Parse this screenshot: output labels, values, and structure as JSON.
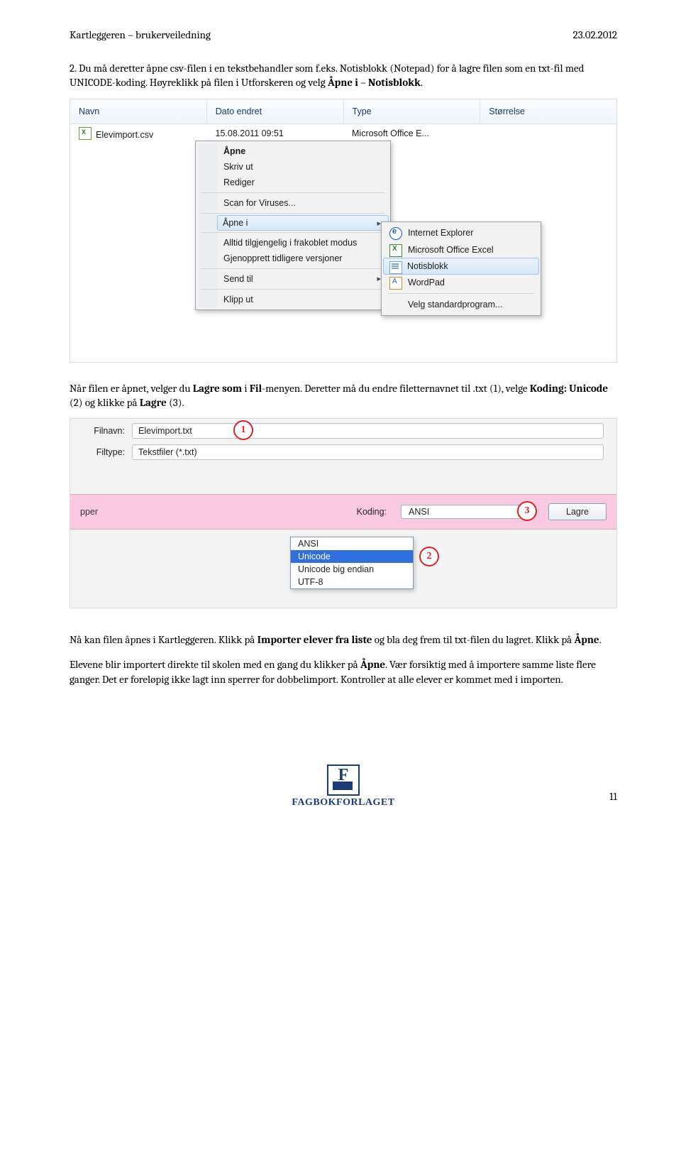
{
  "header": {
    "left": "Kartleggeren – brukerveiledning",
    "right": "23.02.2012"
  },
  "para1_pre": "2.  Du må deretter åpne csv-filen i en tekstbehandler som f.eks. Notisblokk (Notepad) for å lagre filen som en txt-fil med UNICODE-koding. Høyreklikk på filen i Utforskeren og velg ",
  "para1_b1": "Åpne i",
  "para1_mid": " – ",
  "para1_b2": "Notisblokk",
  "para1_end": ".",
  "explorer": {
    "cols": {
      "name": "Navn",
      "date": "Dato endret",
      "type": "Type",
      "size": "Størrelse"
    },
    "file": {
      "name": "Elevimport.csv",
      "date": "15.08.2011 09:51",
      "type": "Microsoft Office E..."
    }
  },
  "ctx": {
    "open": "Åpne",
    "print": "Skriv ut",
    "edit": "Rediger",
    "scan": "Scan for Viruses...",
    "openin": "Åpne i",
    "offline": "Alltid tilgjengelig i frakoblet modus",
    "restore": "Gjenopprett tidligere versjoner",
    "sendto": "Send til",
    "cut": "Klipp ut"
  },
  "submenu": {
    "ie": "Internet Explorer",
    "excel": "Microsoft Office Excel",
    "notepad": "Notisblokk",
    "wordpad": "WordPad",
    "default": "Velg standardprogram..."
  },
  "para2_pre": "Når filen er åpnet, velger du ",
  "para2_b1": "Lagre som",
  "para2_mid1": " i ",
  "para2_b2": "Fil",
  "para2_mid2": "-menyen. Deretter må du endre filetternavnet til .txt (1), velge ",
  "para2_b3": "Koding: Unicode",
  "para2_mid3": " (2) og klikke på ",
  "para2_b4": "Lagre",
  "para2_end": " (3).",
  "save": {
    "lbl_filename": "Filnavn:",
    "filename": "Elevimport.txt",
    "lbl_filetype": "Filtype:",
    "filetype": "Tekstfiler (*.txt)",
    "pper": "pper",
    "lbl_coding": "Koding:",
    "coding_value": "ANSI",
    "btn_save": "Lagre",
    "opts": {
      "ansi": "ANSI",
      "unicode": "Unicode",
      "be": "Unicode big endian",
      "utf8": "UTF-8"
    },
    "c1": "1",
    "c2": "2",
    "c3": "3"
  },
  "para3_pre": "Nå kan filen åpnes i Kartleggeren. Klikk på ",
  "para3_b1": "Importer elever fra liste",
  "para3_mid": " og bla deg frem til txt-filen du lagret. Klikk på ",
  "para3_b2": "Åpne",
  "para3_end": ".",
  "para4_pre": "Elevene blir importert direkte til skolen med en gang du klikker på ",
  "para4_b1": "Åpne",
  "para4_end": ". Vær forsiktig med å importere samme liste flere ganger. Det er foreløpig ikke lagt inn sperrer for dobbelimport. Kontroller at alle elever er kommet med i importen.",
  "footer": {
    "brand": "FAGBOKFORLAGET",
    "F": "F",
    "page": "11"
  }
}
